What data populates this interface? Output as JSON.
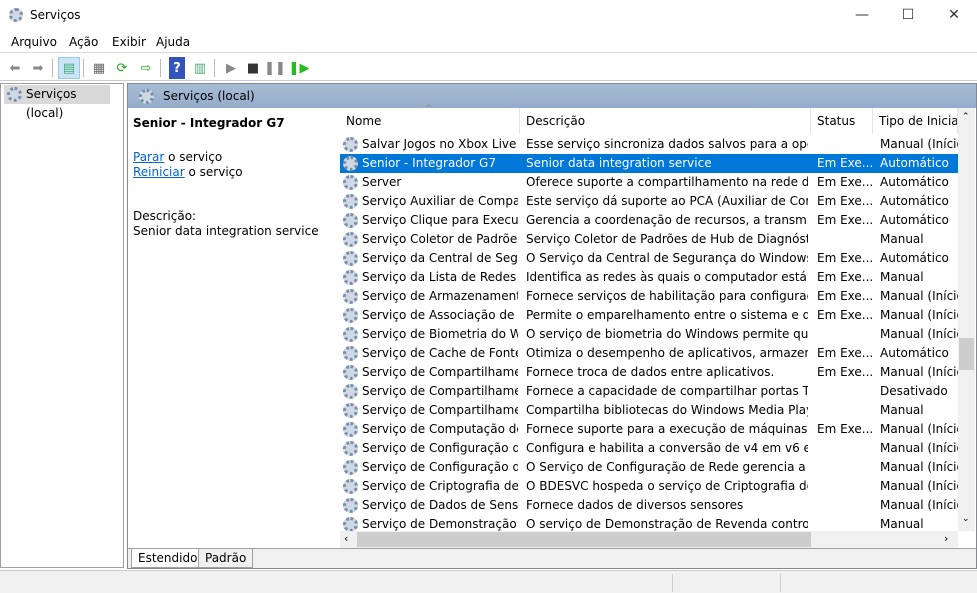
{
  "window": {
    "title": "Serviços",
    "minimize": "—",
    "maximize": "☐",
    "close": "✕"
  },
  "menu": [
    "Arquivo",
    "Ação",
    "Exibir",
    "Ajuda"
  ],
  "tree": {
    "root": "Serviços (local)"
  },
  "pane": {
    "title": "Serviços (local)"
  },
  "detail": {
    "service_name": "Senior - Integrador G7",
    "stop_link": "Parar",
    "stop_text": " o serviço",
    "restart_link": "Reiniciar",
    "restart_text": " o serviço",
    "desc_label": "Descrição:",
    "desc": "Senior data integration service"
  },
  "columns": {
    "name": "Nome",
    "desc": "Descrição",
    "status": "Status",
    "startup": "Tipo de Iniciali"
  },
  "rows": [
    {
      "name": "Salvar Jogos no Xbox Live",
      "desc": "Esse serviço sincroniza dados salvos para a opção s...",
      "status": "",
      "startup": "Manual (Início"
    },
    {
      "name": "Senior - Integrador G7",
      "desc": "Senior data integration service",
      "status": "Em Exe...",
      "startup": "Automático"
    },
    {
      "name": "Server",
      "desc": "Oferece suporte a compartilhamento na rede de ar...",
      "status": "Em Exe...",
      "startup": "Automático"
    },
    {
      "name": "Serviço Auxiliar de Compati...",
      "desc": "Este serviço dá suporte ao PCA (Auxiliar de Compat...",
      "status": "Em Exe...",
      "startup": "Automático"
    },
    {
      "name": "Serviço Clique para Executa...",
      "desc": "Gerencia a coordenação de recursos, a transmissão...",
      "status": "Em Exe...",
      "startup": "Automático"
    },
    {
      "name": "Serviço Coletor de Padrões ...",
      "desc": "Serviço Coletor de Padrões de Hub de Diagnóstico....",
      "status": "",
      "startup": "Manual"
    },
    {
      "name": "Serviço da Central de Segur...",
      "desc": "O Serviço da Central de Segurança do Windows De...",
      "status": "Em Exe...",
      "startup": "Automático"
    },
    {
      "name": "Serviço da Lista de Redes",
      "desc": "Identifica as redes às quais o computador está con...",
      "status": "Em Exe...",
      "startup": "Manual"
    },
    {
      "name": "Serviço de Armazenamento",
      "desc": "Fornece serviços de habilitação para configuração ...",
      "status": "Em Exe...",
      "startup": "Manual (Início"
    },
    {
      "name": "Serviço de Associação de Di...",
      "desc": "Permite o emparelhamento entre o sistema e dispo...",
      "status": "Em Exe...",
      "startup": "Manual (Início"
    },
    {
      "name": "Serviço de Biometria do Wi...",
      "desc": "O serviço de biometria do Windows permite que os...",
      "status": "",
      "startup": "Manual (Início"
    },
    {
      "name": "Serviço de Cache de Fontes ...",
      "desc": "Otimiza o desempenho de aplicativos, armazenand...",
      "status": "Em Exe...",
      "startup": "Automático"
    },
    {
      "name": "Serviço de Compartilhamen...",
      "desc": "Fornece troca de dados entre aplicativos.",
      "status": "Em Exe...",
      "startup": "Manual (Início"
    },
    {
      "name": "Serviço de Compartilhamen...",
      "desc": "Fornece a capacidade de compartilhar portas TCP ...",
      "status": "",
      "startup": "Desativado"
    },
    {
      "name": "Serviço de Compartilhamen...",
      "desc": "Compartilha bibliotecas do Windows Media Player ...",
      "status": "",
      "startup": "Manual"
    },
    {
      "name": "Serviço de Computação de ...",
      "desc": "Fornece suporte para a execução de máquinas virtu...",
      "status": "Em Exe...",
      "startup": "Manual (Início"
    },
    {
      "name": "Serviço de Configuração de...",
      "desc": "Configura e habilita a conversão de v4 em v6 e vice...",
      "status": "",
      "startup": "Manual (Início"
    },
    {
      "name": "Serviço de Configuração de...",
      "desc": "O Serviço de Configuração de Rede gerencia a inst...",
      "status": "",
      "startup": "Manual (Início"
    },
    {
      "name": "Serviço de Criptografia de U...",
      "desc": "O BDESVC hospeda o serviço de Criptografia de Un...",
      "status": "",
      "startup": "Manual (Início"
    },
    {
      "name": "Serviço de Dados de Sensor",
      "desc": "Fornece dados de diversos sensores",
      "status": "",
      "startup": "Manual (Início"
    },
    {
      "name": "Serviço de Demonstração d...",
      "desc": "O serviço de Demonstração de Revenda controlará ...",
      "status": "",
      "startup": "Manual"
    }
  ],
  "tabs": [
    "Estendido",
    "Padrão"
  ],
  "selected_row": 1
}
